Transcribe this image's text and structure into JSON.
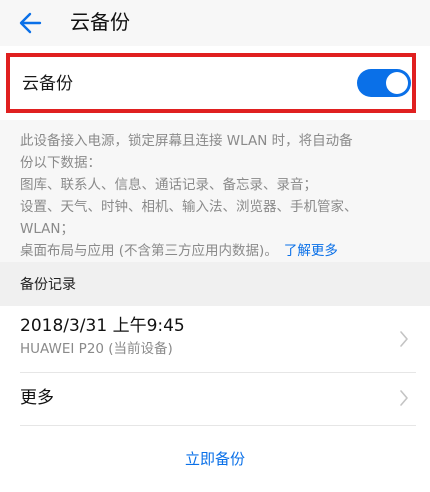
{
  "header": {
    "title": "云备份",
    "back_icon": "arrow-left-icon"
  },
  "toggle": {
    "label": "云备份",
    "state": "on",
    "on_color": "#0a70e8"
  },
  "highlight_color": "#e02020",
  "description": {
    "lines": [
      "此设备接入电源，锁定屏幕且连接 WLAN 时，将自动备",
      "份以下数据：",
      "图库、联系人、信息、通话记录、备忘录、录音；",
      "设置、天气、时钟、相机、输入法、浏览器、手机管家、",
      "WLAN；",
      "桌面布局与应用 (不含第三方应用内数据)。"
    ],
    "link": "了解更多"
  },
  "records": {
    "section_title": "备份记录",
    "latest": {
      "datetime": "2018/3/31 上午9:45",
      "device": "HUAWEI P20 (当前设备)"
    },
    "more_label": "更多"
  },
  "actions": {
    "backup_now": "立即备份"
  },
  "colors": {
    "accent": "#0a70e8",
    "secondary_text": "#8a8a8a",
    "background_gray": "#f7f7f7"
  }
}
